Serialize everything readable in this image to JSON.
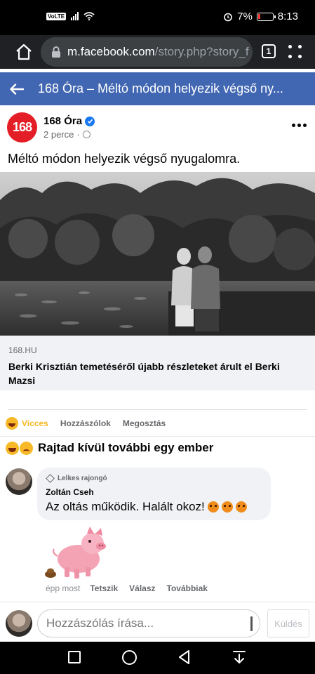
{
  "status_bar": {
    "volte": "VoLTE",
    "battery": "7%",
    "time": "8:13"
  },
  "browser": {
    "url_host": "m.facebook.com",
    "url_path": "/story.php?story_f",
    "tab_count": "1"
  },
  "header": {
    "title": "168 Óra – Méltó módon helyezik végső ny..."
  },
  "post": {
    "avatar_text": "168",
    "page_name": "168 Óra",
    "time": "2 perce",
    "separator": "·",
    "text": "Méltó módon helyezik végső nyugalomra.",
    "link_domain": "168.HU",
    "link_title": "Berki Krisztián temetéséről újabb részleteket árult el Berki Mazsi"
  },
  "actions": {
    "reaction": "Vicces",
    "comment": "Hozzászólok",
    "share": "Megosztás"
  },
  "reactions_summary": {
    "text": "Rajtad kívül további egy ember"
  },
  "comment": {
    "badge": "Lelkes rajongó",
    "author": "Zoltán Cseh",
    "text": "Az oltás működik. Halált okoz!",
    "time": "épp most",
    "like": "Tetszik",
    "reply": "Válasz",
    "more": "Továbbiak"
  },
  "composer": {
    "placeholder": "Hozzászólás írása...",
    "send": "Küldés"
  },
  "colors": {
    "fb_blue": "#4267b2",
    "brand_red": "#e41e26",
    "vicces_yellow": "#f7b928"
  }
}
